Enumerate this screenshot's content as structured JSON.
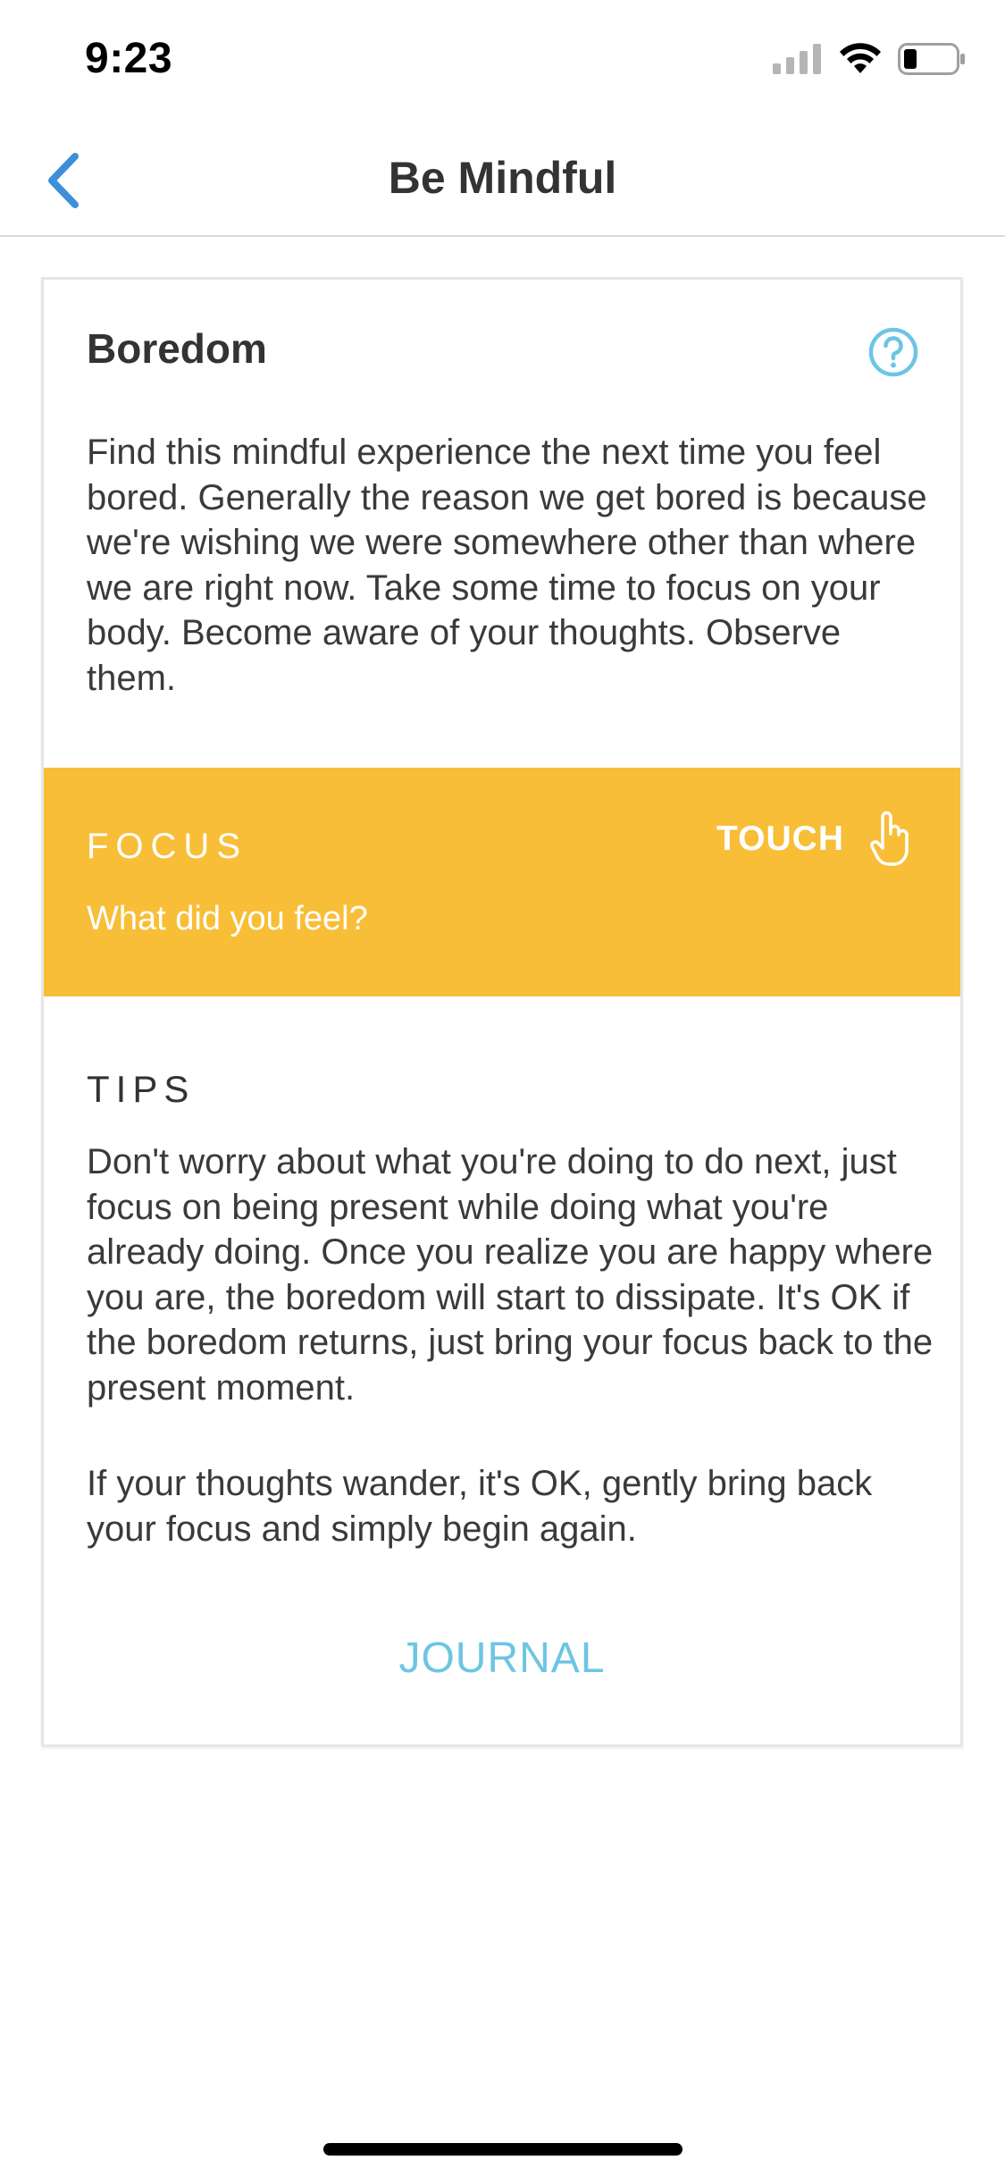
{
  "status_bar": {
    "time": "9:23"
  },
  "nav": {
    "title": "Be Mindful",
    "back_icon": "chevron-left-icon"
  },
  "card": {
    "title": "Boredom",
    "help_icon": "question-circle-icon",
    "description": "Find this mindful experience the next time you feel bored. Generally the reason we get bored is because we're wishing we were somewhere other than where we are right now. Take some time to focus on your body. Become aware of your thoughts. Observe them.",
    "focus": {
      "label": "FOCUS",
      "question": "What did you feel?",
      "action_label": "TOUCH",
      "action_icon": "hand-pointer-icon",
      "background_color": "#f8be38"
    },
    "tips": {
      "heading": "TIPS",
      "paragraphs": [
        "Don't worry about what you're doing to do next, just focus on being present while doing what you're already doing. Once you realize you are happy where you are, the boredom will start to dissipate. It's OK if the boredom returns, just bring your focus back to the present moment.",
        "If your thoughts wander, it's OK, gently bring back your focus and simply begin again."
      ]
    },
    "journal_label": "JOURNAL"
  },
  "colors": {
    "accent_blue": "#3d8fd9",
    "link_blue": "#6dc5e3",
    "focus_yellow": "#f8be38"
  }
}
